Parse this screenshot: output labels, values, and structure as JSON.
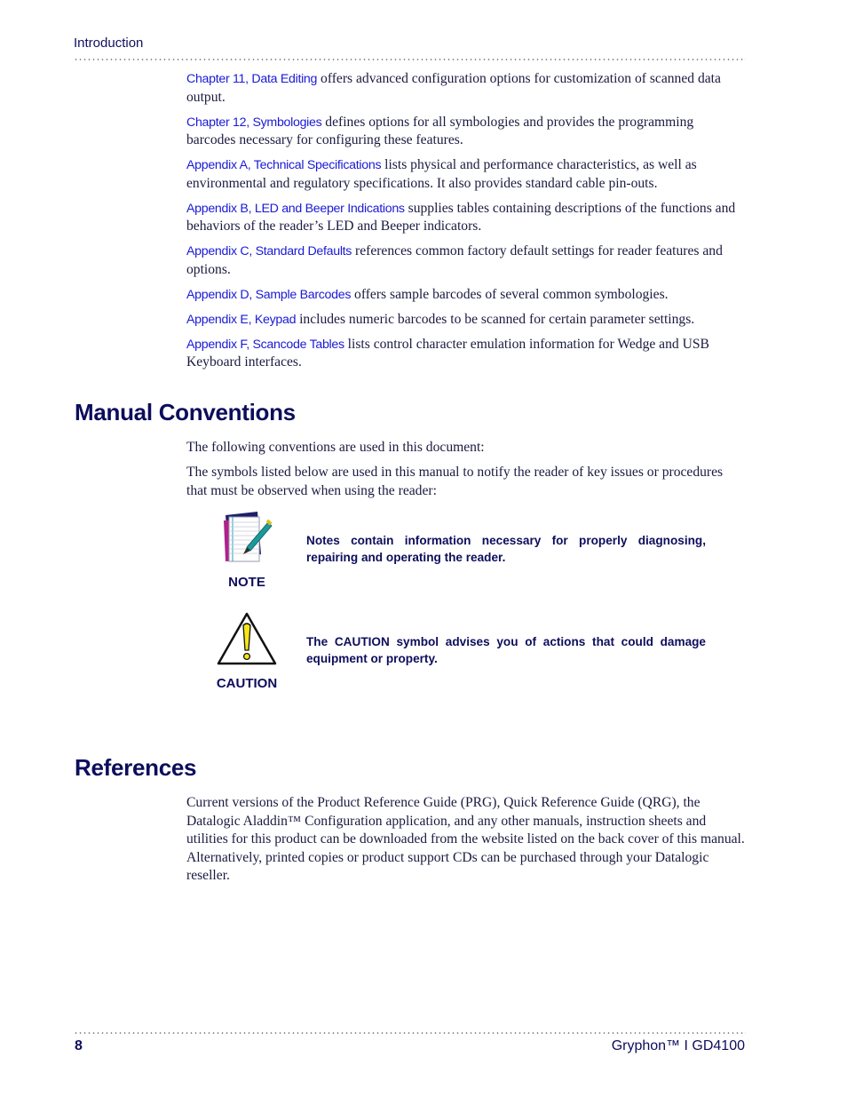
{
  "header": {
    "running_title": "Introduction"
  },
  "chapter_list": [
    {
      "link": "Chapter 11, Data Editing",
      "text": " offers advanced configuration options for customization of scanned data output."
    },
    {
      "link": "Chapter 12, Symbologies",
      "text": " defines options for all symbologies and provides the programming barcodes necessary for configuring these features."
    },
    {
      "link": "Appendix A, Technical Specifications",
      "text": " lists physical and performance characteristics, as well as environmental and regulatory specifications. It also provides standard cable pin-outs."
    },
    {
      "link": "Appendix B, LED and Beeper Indications",
      "text": " supplies tables containing descriptions of the functions and behaviors of the reader’s LED and Beeper indicators."
    },
    {
      "link": "Appendix C, Standard Defaults",
      "text": " references common factory default settings for reader features and options."
    },
    {
      "link": "Appendix D, Sample Barcodes",
      "text": " offers sample barcodes of several common symbologies."
    },
    {
      "link": "Appendix E, Keypad",
      "text": " includes numeric barcodes to be scanned for certain parameter settings."
    },
    {
      "link": "Appendix F, Scancode Tables",
      "text": " lists control character emulation information for Wedge and USB Keyboard interfaces."
    }
  ],
  "conventions": {
    "heading": "Manual Conventions",
    "intro": "The following conventions are used in this document:",
    "symbols_text": "The symbols listed below are used in this manual to notify the reader of key issues or procedures that must be observed when using the reader:",
    "note": {
      "label": "NOTE",
      "icon": "notepad-pen-icon",
      "text": "Notes contain information necessary for properly diagnosing, repairing and operating the reader."
    },
    "caution": {
      "label": "CAUTION",
      "icon": "warning-triangle-icon",
      "text": "The CAUTION symbol advises you of actions that could damage equipment or property."
    }
  },
  "references": {
    "heading": "References",
    "text": "Current versions of the Product Reference Guide (PRG), Quick Reference Guide (QRG), the Datalogic Aladdin™ Configuration application, and any other manuals, instruction sheets and utilities for this product can be downloaded from the website listed on the back cover of this manual. Alternatively, printed copies or product support CDs can be purchased through your Datalogic reseller."
  },
  "footer": {
    "page_number": "8",
    "product": "Gryphon™ I GD4100"
  },
  "colors": {
    "link": "#1a1ad6",
    "heading": "#0d0d5c",
    "caution_yellow": "#f5e616"
  }
}
